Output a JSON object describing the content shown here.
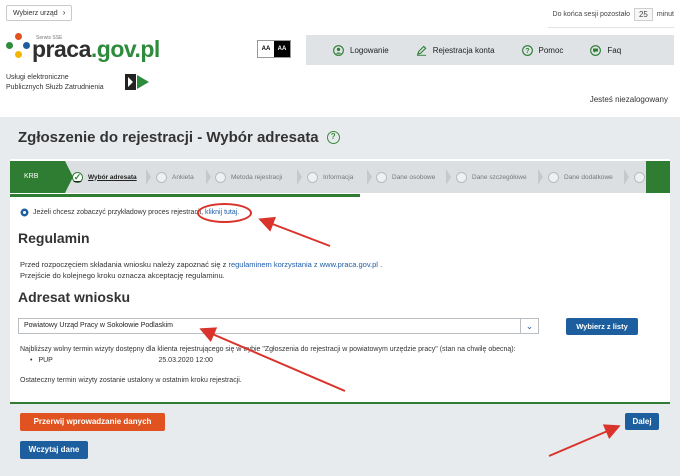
{
  "topbar": {
    "office_button": "Wybierz urząd",
    "session_label": "Do końca sesji pozostało",
    "session_minutes": "25",
    "session_unit": "minut"
  },
  "brand": {
    "logo_prefix": "praca",
    "logo_suffix": ".gov.pl",
    "logo_sup": "Serwis SSE",
    "services_line1": "Usługi elektroniczne",
    "services_line2": "Publicznych Służb Zatrudnienia"
  },
  "contrast": {
    "normal": "AA",
    "high": "AA"
  },
  "nav": [
    {
      "label": "Logowanie",
      "icon": "user-icon"
    },
    {
      "label": "Rejestracja konta",
      "icon": "pen-icon"
    },
    {
      "label": "Pomoc",
      "icon": "help-icon"
    },
    {
      "label": "Faq",
      "icon": "faq-icon"
    }
  ],
  "user_status": "Jesteś niezalogowany",
  "page_title": "Zgłoszenie do rejestracji - Wybór adresata",
  "steps": {
    "krb": "KRB",
    "items": [
      "Wybór adresata",
      "Ankieta",
      "Metoda rejestracji",
      "Informacja",
      "Dane osobowe",
      "Dane szczegółowe",
      "Dane dodatkowe"
    ]
  },
  "info": {
    "text": "Jeżeli chcesz zobaczyć przykładowy proces rejestracji",
    "link": "kliknij tutaj."
  },
  "regulamin": {
    "heading": "Regulamin",
    "line1_pre": "Przed rozpoczęciem składania wniosku należy zapoznać się z",
    "line1_link": "regulaminem korzystania z www.praca.gov.pl",
    "line1_post": ".",
    "line2": "Przejście do kolejnego kroku oznacza akceptację regulaminu."
  },
  "adresat": {
    "heading": "Adresat wniosku",
    "selected": "Powiatowy Urząd Pracy w Sokołowie Podlaskim",
    "pick_button": "Wybierz z listy",
    "term_line": "Najbliższy wolny termin wizyty dostępny dla klienta rejestrującego się w trybie \"Zgłoszenia do rejestracji w powiatowym urzędzie pracy\" (stan na chwilę obecną):",
    "bullet": "•",
    "term_name": "PUP",
    "term_date": "25.03.2020 12:00",
    "final_note": "Ostateczny termin wizyty zostanie ustalony w ostatnim kroku rejestracji."
  },
  "buttons": {
    "abort": "Przerwij wprowadzanie danych",
    "load": "Wczytaj dane",
    "next": "Dalej"
  },
  "colors": {
    "green": "#2e7d32",
    "blue": "#1d5f9e",
    "orange": "#e0521f",
    "annotation_red": "#d9332b"
  }
}
